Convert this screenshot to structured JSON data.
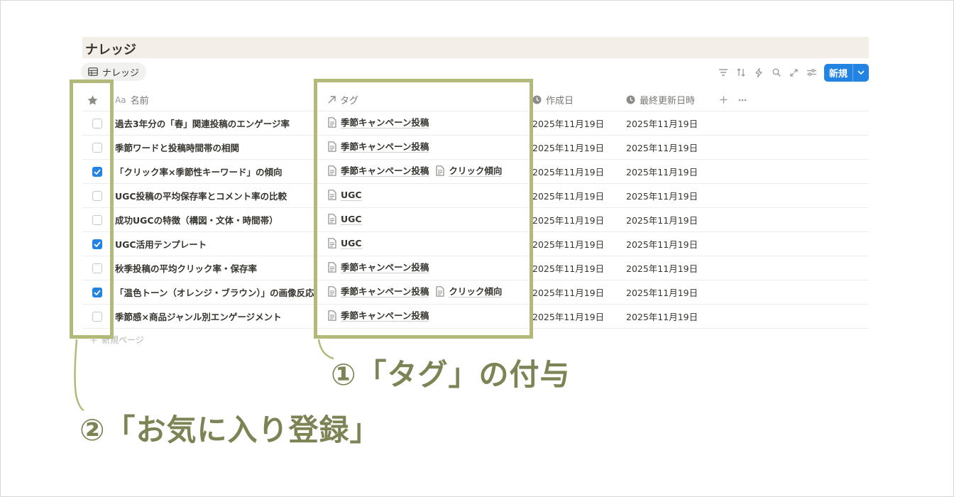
{
  "page": {
    "title": "ナレッジ",
    "view_tab": "ナレッジ",
    "new_button": "新規",
    "new_page": "新規ページ"
  },
  "toolbar": {
    "icons": [
      "filter-icon",
      "sort-icon",
      "lightning-icon",
      "search-icon",
      "expand-icon",
      "settings-icon"
    ]
  },
  "columns": {
    "name": "名前",
    "tag": "タグ",
    "created": "作成日",
    "updated": "最終更新日時",
    "name_prefix": "Aa"
  },
  "rows": [
    {
      "name": "過去3年分の「春」関連投稿のエンゲージ率",
      "tags": [
        "季節キャンペーン投稿"
      ],
      "created": "2025年11月19日",
      "updated": "2025年11月19日",
      "starred": false
    },
    {
      "name": "季節ワードと投稿時間帯の相関",
      "tags": [
        "季節キャンペーン投稿"
      ],
      "created": "2025年11月19日",
      "updated": "2025年11月19日",
      "starred": false
    },
    {
      "name": "「クリック率×季節性キーワード」の傾向",
      "tags": [
        "季節キャンペーン投稿",
        "クリック傾向"
      ],
      "created": "2025年11月19日",
      "updated": "2025年11月19日",
      "starred": true
    },
    {
      "name": "UGC投稿の平均保存率とコメント率の比較",
      "tags": [
        "UGC"
      ],
      "created": "2025年11月19日",
      "updated": "2025年11月19日",
      "starred": false
    },
    {
      "name": "成功UGCの特徴（構図・文体・時間帯）",
      "tags": [
        "UGC"
      ],
      "created": "2025年11月19日",
      "updated": "2025年11月19日",
      "starred": false
    },
    {
      "name": "UGC活用テンプレート",
      "tags": [
        "UGC"
      ],
      "created": "2025年11月19日",
      "updated": "2025年11月19日",
      "starred": true
    },
    {
      "name": "秋季投稿の平均クリック率・保存率",
      "tags": [
        "季節キャンペーン投稿"
      ],
      "created": "2025年11月19日",
      "updated": "2025年11月19日",
      "starred": false
    },
    {
      "name": "「温色トーン（オレンジ・ブラウン）」の画像反応",
      "tags": [
        "季節キャンペーン投稿",
        "クリック傾向"
      ],
      "created": "2025年11月19日",
      "updated": "2025年11月19日",
      "starred": true
    },
    {
      "name": "季節感×商品ジャンル別エンゲージメント",
      "tags": [
        "季節キャンペーン投稿"
      ],
      "created": "2025年11月19日",
      "updated": "2025年11月19日",
      "starred": false
    }
  ],
  "annotations": {
    "tag": "①「タグ」の付与",
    "favorite": "②「お気に入り登録」"
  },
  "colors": {
    "highlight": "#b3b978",
    "annotation_text": "#7d8354",
    "title_band": "#f4eee8",
    "accent": "#2383e2"
  }
}
